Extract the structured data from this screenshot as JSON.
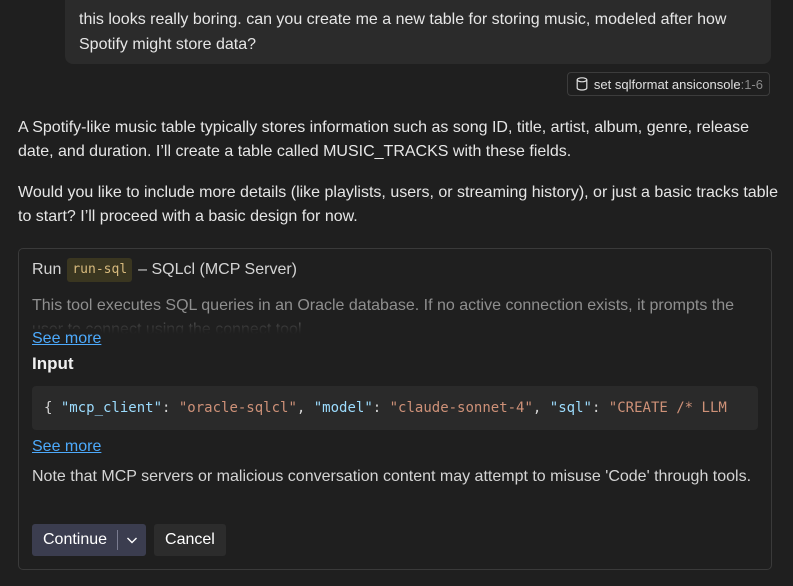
{
  "user_message": {
    "text": "this looks really boring. can you create me a new table for storing music, modeled after how Spotify might store data?"
  },
  "context_chip": {
    "icon": "database-icon",
    "label": "set sqlformat ansiconsole",
    "range": ":1-6"
  },
  "assistant": {
    "paragraph_1": "A Spotify-like music table typically stores information such as song ID, title, artist, album, genre, release date, and duration. I’ll create a table called MUSIC_TRACKS with these fields.",
    "paragraph_2": "Would you like to include more details (like playlists, users, or streaming history), or just a basic tracks table to start? I’ll proceed with a basic design for now."
  },
  "tool_card": {
    "run_label": "Run",
    "tool_name": "run-sql",
    "server_label": "– SQLcl (MCP Server)",
    "description": "This tool executes SQL queries in an Oracle database. If no active connection exists, it prompts the user to connect using the connect tool",
    "see_more_1": "See more",
    "input_heading": "Input",
    "code": {
      "open": "{ ",
      "k1": "\"mcp_client\"",
      "v1": "\"oracle-sqlcl\"",
      "k2": "\"model\"",
      "v2": "\"claude-sonnet-4\"",
      "k3": "\"sql\"",
      "v3": "\"CREATE /* LLM",
      "colon": ": ",
      "comma": ", "
    },
    "see_more_2": "See more",
    "note": "Note that MCP servers or malicious conversation content may attempt to misuse 'Code' through tools.",
    "continue_label": "Continue",
    "cancel_label": "Cancel"
  }
}
